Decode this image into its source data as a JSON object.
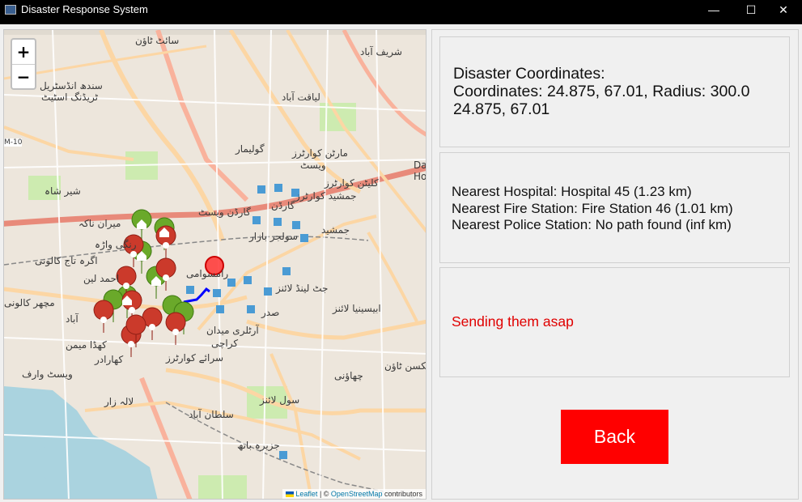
{
  "window": {
    "title": "Disaster Response System",
    "minimize": "—",
    "maximize": "☐",
    "close": "✕"
  },
  "map": {
    "zoom_in": "+",
    "zoom_out": "−",
    "attribution": {
      "leaflet": "Leaflet",
      "separator": " | © ",
      "osm": "OpenStreetMap",
      "suffix": " contributors"
    },
    "labels": {
      "saeed_town": "سائٹ ٹاؤن",
      "sindh_industrial": "سندھ انڈسٹریل",
      "trading_estate": "ٹریڈنگ اسٹیٹ",
      "liaquatabad": "لیاقت آباد",
      "shareef_abad": "شریف آباد",
      "golimar": "گولیمار",
      "martin_quarters": "مارٹن کوارٹرز",
      "west": "ویسٹ",
      "clayton_quarters": "کلیٹن کوارٹرز",
      "jamshed_quarters": "جمشید کوارٹرز",
      "garden": "گارڈن",
      "garden_west": "گارڈن ویسٹ",
      "soldier_bazar": "سولجر بازار",
      "jamshed": "جمشید",
      "sher_shah": "شیر شاہ",
      "miran_naka": "میران ناکہ",
      "rangiwara": "رنگی واڑہ",
      "agra_taj": "اگرہ تاج کالونی",
      "ahmed_lane": "احمد لین",
      "machhar_colony": "مچھر کالونی",
      "ramaswami": "رامسوامی",
      "jat_line": "جٹ لینڈ لائنز",
      "saddar": "صدر",
      "abyssinia": "ابیسینیا لائنز",
      "kharadar": "کھارادر",
      "kehda_mem": "کھڈا میمن",
      "kiamari": "کراچی",
      "artillery": "آرٹلری میدان",
      "west_wharf": "ویسٹ وارف",
      "serai": "سرائے کوارٹرز",
      "lala_zar": "لالہ زار",
      "sultanabad": "سلطان آباد",
      "civil_lines": "سول لائنز",
      "jinnah_town": "جیکسن ٹاؤن",
      "chakiwara": "چھاؤنی",
      "jazira": "جزیرہ باتھ",
      "dawood": "Dawo",
      "hou": "Ho",
      "m10": "M-10",
      "abad": "آباد"
    }
  },
  "info": {
    "coords_heading": "Disaster Coordinates:",
    "coords_line": "Coordinates: 24.875, 67.01, Radius: 300.0",
    "coords_short": "24.875, 67.01",
    "nearest_hospital": "Nearest Hospital: Hospital 45 (1.23 km)",
    "nearest_fire": "Nearest Fire Station: Fire Station 46 (1.01 km)",
    "nearest_police": "Nearest Police Station: No path found (inf km)",
    "status_message": "Sending them asap",
    "back_label": "Back"
  },
  "colors": {
    "status_text": "#e00000",
    "back_button": "#ff0000",
    "marker_red": "#cb3a2b",
    "marker_green": "#6aa92a",
    "circle": "#ff3333",
    "route": "#0000ff"
  }
}
